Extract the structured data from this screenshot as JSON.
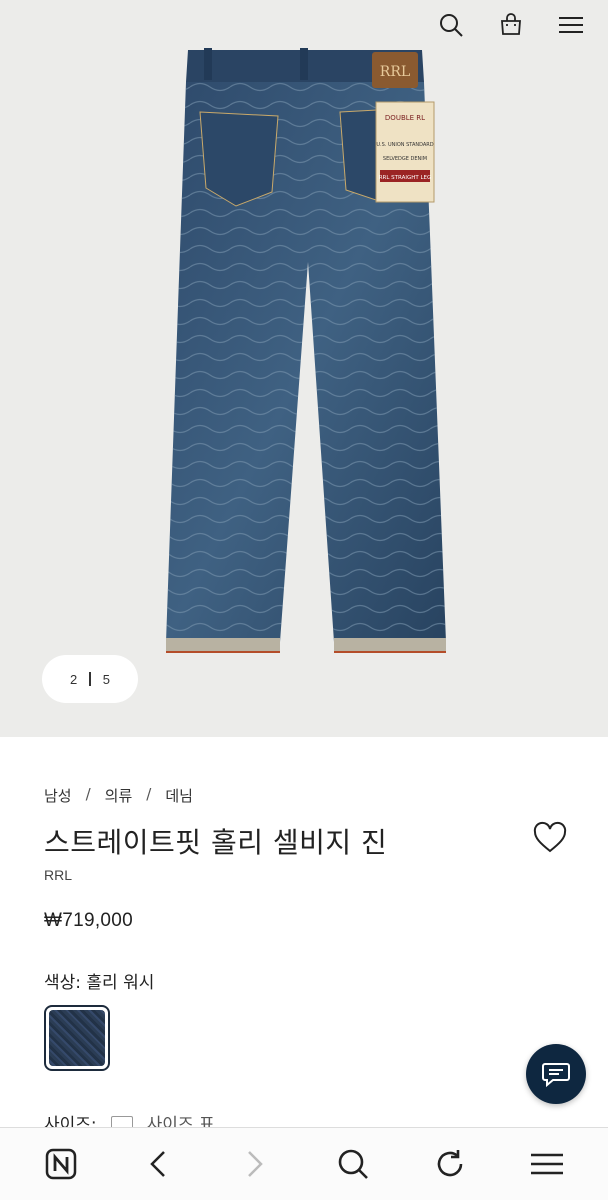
{
  "gallery": {
    "current": "2",
    "total": "5"
  },
  "top_icons": [
    "search-icon",
    "shopping-bag-icon",
    "menu-icon"
  ],
  "product": {
    "breadcrumb": [
      "남성",
      "의류",
      "데님"
    ],
    "title": "스트레이트핏 홀리 셀비지 진",
    "brand": "RRL",
    "price": "₩719,000",
    "color_label": "색상: 홀리 워시",
    "size_label": "사이즈:",
    "size_chart_label": "사이즈 표"
  },
  "jeans_patch": {
    "leather": "RRL",
    "label_lines": [
      "DOUBLE RL",
      "U.S. UNION STANDARD",
      "SELVEDGE DENIM",
      "RRL STRAIGHT LEG"
    ]
  },
  "bottom_nav": [
    "naver-icon",
    "back-icon",
    "forward-icon",
    "search-icon",
    "reload-icon",
    "menu-icon"
  ],
  "colors": {
    "denim": "#2e4a6b",
    "chat_button": "#0e2740",
    "hero_bg": "#ececea"
  }
}
